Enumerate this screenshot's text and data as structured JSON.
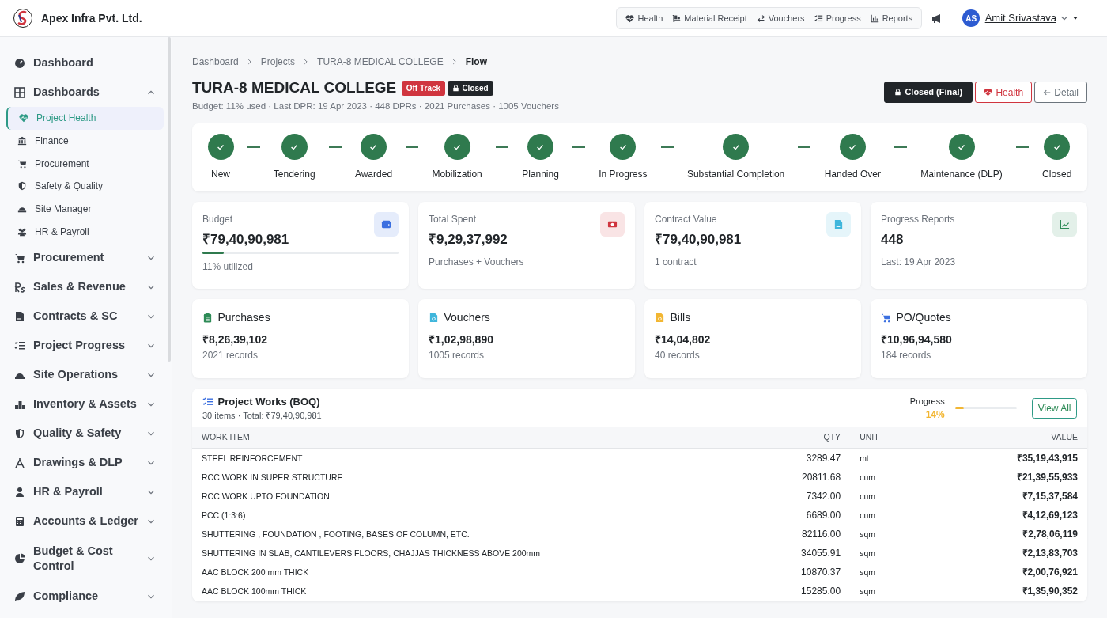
{
  "brand": {
    "name": "Apex Infra Pvt. Ltd."
  },
  "topnav": {
    "links": [
      {
        "label": "Health"
      },
      {
        "label": "Material Receipt"
      },
      {
        "label": "Vouchers"
      },
      {
        "label": "Progress"
      },
      {
        "label": "Reports"
      }
    ],
    "user": {
      "initials": "AS",
      "name": "Amit Srivastava"
    }
  },
  "sidebar": {
    "items": [
      {
        "label": "Dashboard"
      },
      {
        "label": "Dashboards",
        "expanded": true,
        "children": [
          {
            "label": "Project Health",
            "selected": true
          },
          {
            "label": "Finance",
            "selected": false
          },
          {
            "label": "Procurement",
            "selected": false
          },
          {
            "label": "Safety & Quality",
            "selected": false
          },
          {
            "label": "Site Manager",
            "selected": false
          },
          {
            "label": "HR & Payroll",
            "selected": false
          }
        ]
      },
      {
        "label": "Procurement",
        "expanded": false
      },
      {
        "label": "Sales & Revenue",
        "expanded": false
      },
      {
        "label": "Contracts & SC",
        "expanded": false
      },
      {
        "label": "Project Progress",
        "expanded": false
      },
      {
        "label": "Site Operations",
        "expanded": false
      },
      {
        "label": "Inventory & Assets",
        "expanded": false
      },
      {
        "label": "Quality & Safety",
        "expanded": false
      },
      {
        "label": "Drawings & DLP",
        "expanded": false
      },
      {
        "label": "HR & Payroll",
        "expanded": false
      },
      {
        "label": "Accounts & Ledger",
        "expanded": false
      },
      {
        "label": "Budget & Cost Control",
        "expanded": false
      },
      {
        "label": "Compliance",
        "expanded": false
      }
    ]
  },
  "breadcrumb": [
    "Dashboard",
    "Projects",
    "TURA-8 MEDICAL COLLEGE",
    "Flow"
  ],
  "header": {
    "title": "TURA-8 MEDICAL COLLEGE",
    "badges": [
      {
        "label": "Off Track",
        "kind": "danger"
      },
      {
        "label": "Closed",
        "kind": "dark"
      }
    ],
    "subtitle": "Budget: 11% used · Last DPR: 19 Apr 2023 · 448 DPRs · 2021 Purchases · 1005 Vouchers",
    "actions": [
      {
        "label": "Closed (Final)",
        "kind": "dark"
      },
      {
        "label": "Health",
        "kind": "danger"
      },
      {
        "label": "Detail",
        "kind": "secondary"
      }
    ]
  },
  "stages": [
    {
      "label": "New",
      "done": true
    },
    {
      "label": "Tendering",
      "done": true
    },
    {
      "label": "Awarded",
      "done": true
    },
    {
      "label": "Mobilization",
      "done": true
    },
    {
      "label": "Planning",
      "done": true
    },
    {
      "label": "In Progress",
      "done": true
    },
    {
      "label": "Substantial Completion",
      "done": true
    },
    {
      "label": "Handed Over",
      "done": true
    },
    {
      "label": "Maintenance (DLP)",
      "done": true
    },
    {
      "label": "Closed",
      "done": true
    }
  ],
  "stats": [
    {
      "label": "Budget",
      "value": "₹79,40,90,981",
      "note": "11% utilized",
      "level": 0.11,
      "color": "#3b6fe0"
    },
    {
      "label": "Total Spent",
      "value": "₹9,29,37,992",
      "note": "Purchases + Vouchers",
      "color": "#d0353f"
    },
    {
      "label": "Contract Value",
      "value": "₹79,40,90,981",
      "note": "1 contract",
      "color": "#3fb6dc"
    },
    {
      "label": "Progress Reports",
      "value": "448",
      "note": "Last: 19 Apr 2023",
      "color": "#2e8b57"
    }
  ],
  "summaries": [
    {
      "label": "Purchases",
      "value": "₹8,26,39,102",
      "note": "2021 records",
      "color": "#2e8b57"
    },
    {
      "label": "Vouchers",
      "value": "₹1,02,98,890",
      "note": "1005 records",
      "color": "#3fb6dc"
    },
    {
      "label": "Bills",
      "value": "₹14,04,802",
      "note": "40 records",
      "color": "#f2b632"
    },
    {
      "label": "PO/Quotes",
      "value": "₹10,96,94,580",
      "note": "184 records",
      "color": "#3b6fe0"
    }
  ],
  "boq": {
    "title": "Project Works (BOQ)",
    "subtitle": "30 items · Total: ₹79,40,90,981",
    "progress_label": "Progress",
    "progress_value": "14%",
    "level": 0.14,
    "button": "View All",
    "table": {
      "columns": [
        "WORK ITEM",
        "QTY",
        "UNIT",
        "VALUE"
      ],
      "rows": [
        [
          "STEEL REINFORCEMENT",
          "3289.47",
          "mt",
          "₹35,19,43,915"
        ],
        [
          "RCC WORK IN SUPER STRUCTURE",
          "20811.68",
          "cum",
          "₹21,39,55,933"
        ],
        [
          "RCC WORK UPTO FOUNDATION",
          "7342.00",
          "cum",
          "₹7,15,37,584"
        ],
        [
          "PCC (1:3:6)",
          "6689.00",
          "cum",
          "₹4,12,69,123"
        ],
        [
          "SHUTTERING , FOUNDATION , FOOTING, BASES OF COLUMN, ETC.",
          "82116.00",
          "sqm",
          "₹2,78,06,119"
        ],
        [
          "SHUTTERING IN SLAB, CANTILEVERS FLOORS, CHAJJAS THICKNESS ABOVE 200mm",
          "34055.91",
          "sqm",
          "₹2,13,83,703"
        ],
        [
          "AAC BLOCK 200 mm THICK",
          "10870.37",
          "sqm",
          "₹2,00,76,921"
        ],
        [
          "AAC BLOCK 100mm THICK",
          "15285.00",
          "sqm",
          "₹1,35,90,352"
        ]
      ]
    }
  }
}
